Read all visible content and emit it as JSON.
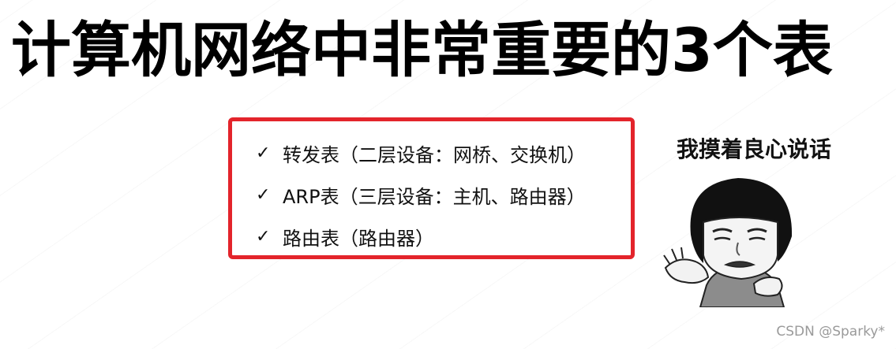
{
  "title": "计算机网络中非常重要的3个表",
  "tables": [
    {
      "check": "✓",
      "text": "转发表（二层设备：网桥、交换机）"
    },
    {
      "check": "✓",
      "text": "ARP表（三层设备：主机、路由器）"
    },
    {
      "check": "✓",
      "text": "路由表（路由器）"
    }
  ],
  "meme": {
    "caption": "我摸着良心说话"
  },
  "credit": "CSDN @Sparky*",
  "colors": {
    "box_border": "#e3242b",
    "title": "#000000"
  }
}
